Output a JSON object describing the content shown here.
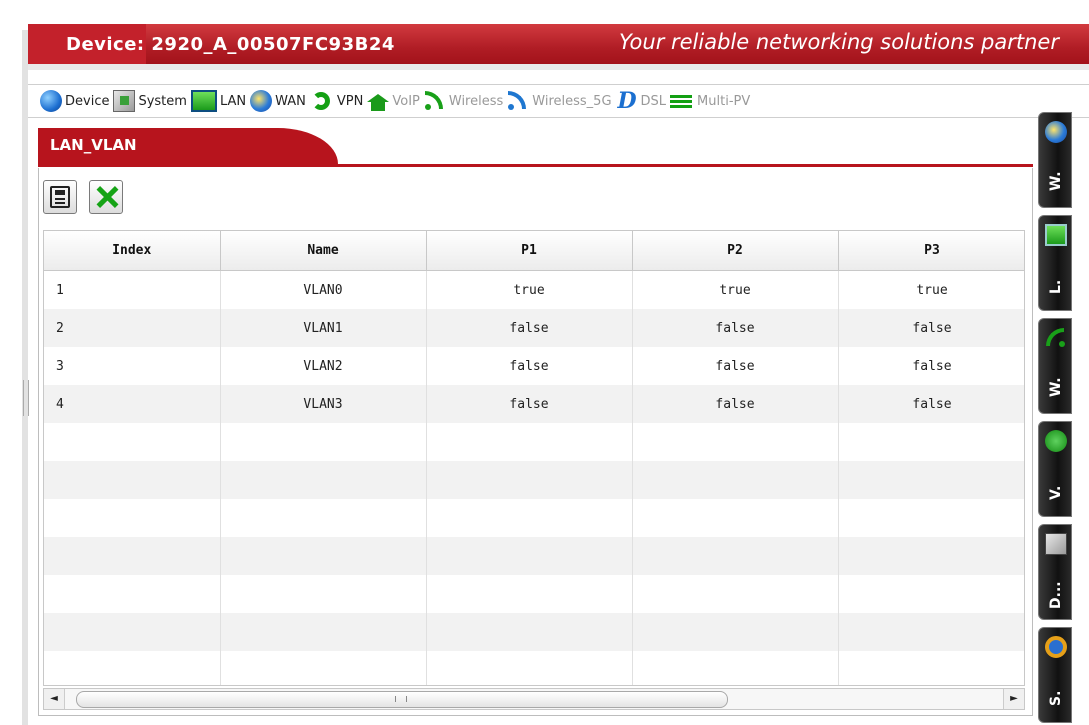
{
  "header": {
    "device_title": "Device: 2920_A_00507FC93B24",
    "slogan": "Your reliable networking solutions partner"
  },
  "nav": {
    "items": [
      {
        "label": "Device",
        "icon": "globe-icon",
        "enabled": true
      },
      {
        "label": "System",
        "icon": "system-icon",
        "enabled": true
      },
      {
        "label": "LAN",
        "icon": "lan-monitor-icon",
        "enabled": true
      },
      {
        "label": "WAN",
        "icon": "wan-globe-icon",
        "enabled": true
      },
      {
        "label": "VPN",
        "icon": "vpn-icon",
        "enabled": true
      },
      {
        "label": "VoIP",
        "icon": "voip-house-icon",
        "enabled": false
      },
      {
        "label": "Wireless",
        "icon": "wireless-icon",
        "enabled": false
      },
      {
        "label": "Wireless_5G",
        "icon": "wireless-5g-icon",
        "enabled": false
      },
      {
        "label": "DSL",
        "icon": "dsl-icon",
        "enabled": false
      },
      {
        "label": "Multi-PV",
        "icon": "multi-pvc-icon",
        "enabled": false
      }
    ]
  },
  "page": {
    "tab_label": "LAN_VLAN"
  },
  "toolbar": {
    "save_icon": "save-icon",
    "tools_icon": "tools-icon"
  },
  "table": {
    "columns": [
      "Index",
      "Name",
      "P1",
      "P2",
      "P3"
    ],
    "rows": [
      [
        "1",
        "VLAN0",
        "true",
        "true",
        "true"
      ],
      [
        "2",
        "VLAN1",
        "false",
        "false",
        "false"
      ],
      [
        "3",
        "VLAN2",
        "false",
        "false",
        "false"
      ],
      [
        "4",
        "VLAN3",
        "false",
        "false",
        "false"
      ]
    ]
  },
  "scrollbar": {
    "left_arrow": "◄",
    "right_arrow": "►"
  },
  "right_tabs": [
    {
      "label": "W.",
      "icon": "wan-icon"
    },
    {
      "label": "L.",
      "icon": "lan-icon"
    },
    {
      "label": "W.",
      "icon": "wireless-icon"
    },
    {
      "label": "V.",
      "icon": "voip-icon"
    },
    {
      "label": "D...",
      "icon": "diagnostics-icon"
    },
    {
      "label": "S.",
      "icon": "system-settings-icon"
    }
  ],
  "colors": {
    "brand_red": "#b7141d",
    "nav_green": "#15a315",
    "nav_blue": "#1f77d0"
  }
}
